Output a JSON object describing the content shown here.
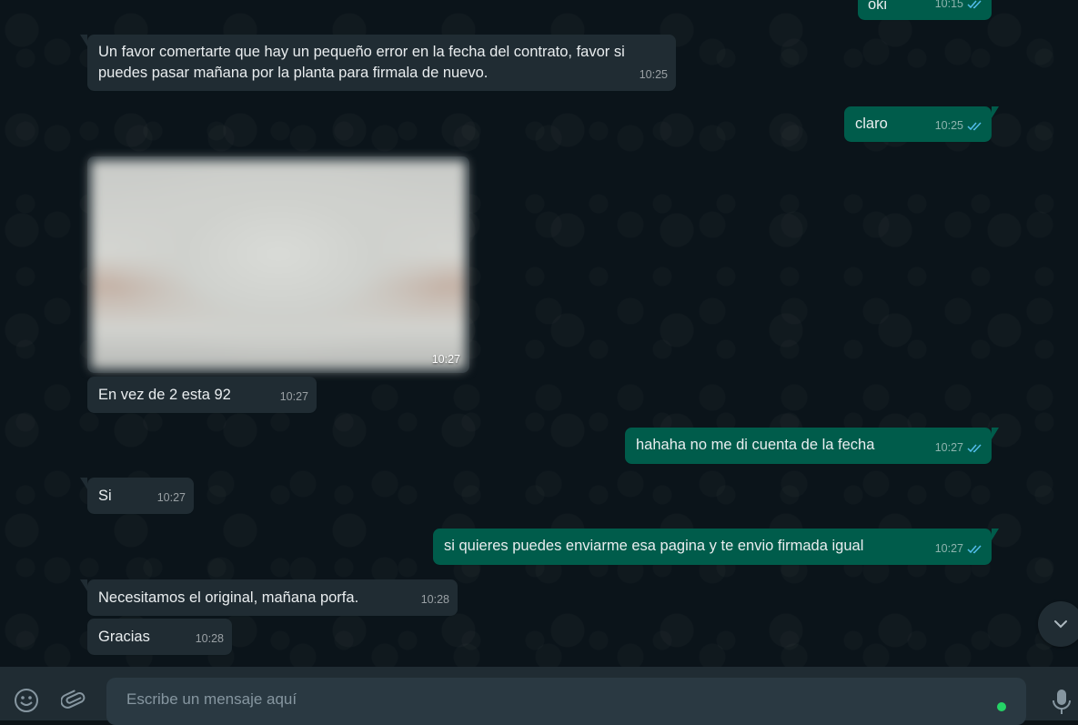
{
  "messages": [
    {
      "dir": "out",
      "text": "oki",
      "time": "10:15",
      "read": true
    },
    {
      "dir": "in",
      "text": "Un favor comertarte que hay un pequeño error en la fecha del contrato, favor si puedes pasar mañana por la planta para firmala de nuevo.",
      "time": "10:25"
    },
    {
      "dir": "out",
      "text": "claro",
      "time": "10:25",
      "read": true
    },
    {
      "dir": "in",
      "type": "image",
      "time": "10:27"
    },
    {
      "dir": "in",
      "text": "En vez de 2 esta 92",
      "time": "10:27"
    },
    {
      "dir": "out",
      "text": "hahaha no me di cuenta de la fecha",
      "time": "10:27",
      "read": true
    },
    {
      "dir": "in",
      "text": "Si",
      "time": "10:27"
    },
    {
      "dir": "out",
      "text": "si quieres puedes enviarme esa pagina y te envio firmada igual",
      "time": "10:27",
      "read": true
    },
    {
      "dir": "in",
      "text": "Necesitamos el original, mañana porfa.",
      "time": "10:28"
    },
    {
      "dir": "in",
      "text": "Gracias",
      "time": "10:28"
    }
  ],
  "composer": {
    "placeholder": "Escribe un mensaje aquí",
    "emoji_icon": "emoji-icon",
    "attach_icon": "paperclip-icon",
    "mic_icon": "microphone-icon"
  },
  "scroll_down_icon": "chevron-down-icon",
  "colors": {
    "incoming_bubble": "#202c33",
    "outgoing_bubble": "#005c4b",
    "read_ticks": "#53bdeb",
    "background": "#0b141a"
  }
}
